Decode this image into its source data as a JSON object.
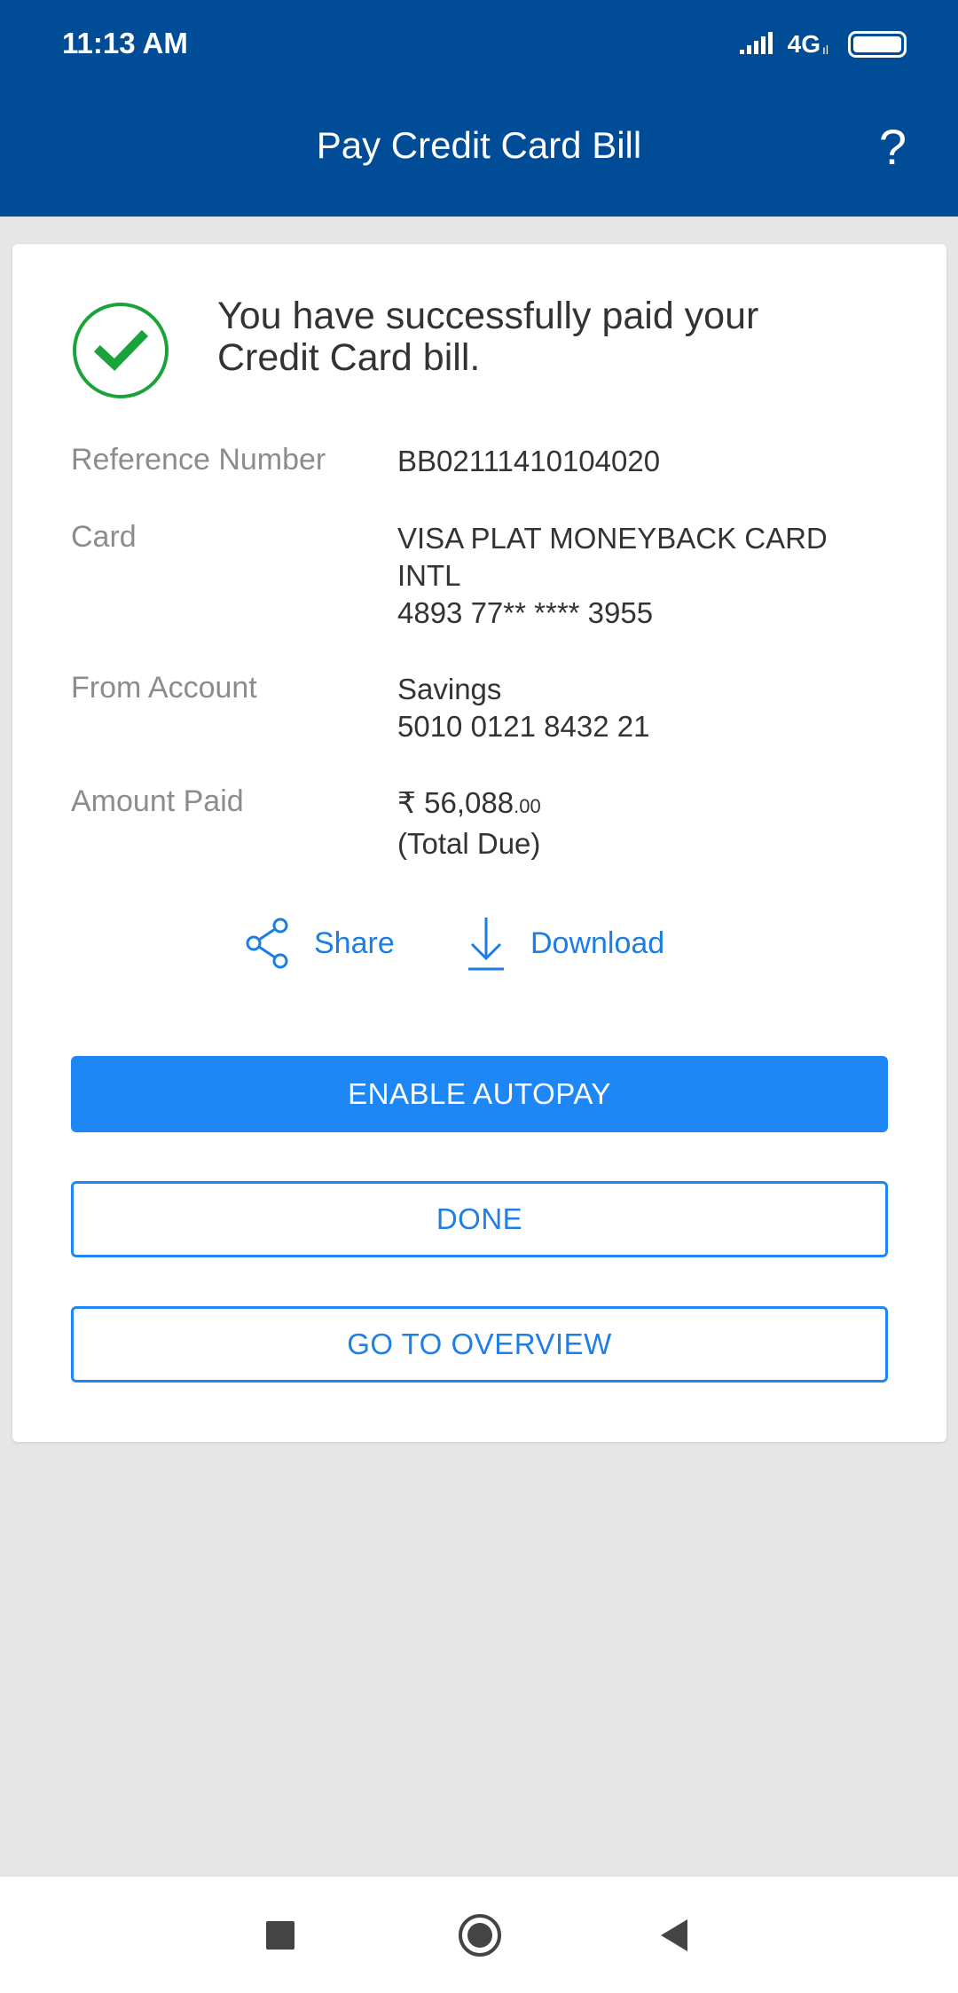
{
  "status_bar": {
    "time": "11:13 AM",
    "network": "4G",
    "network_sub": "ıl",
    "icons": [
      "signal-icon",
      "battery-icon"
    ]
  },
  "header": {
    "title": "Pay Credit Card Bill",
    "help_label": "?"
  },
  "confirmation": {
    "icon": "check-circle-icon",
    "message": "You have successfully paid your Credit Card bill.",
    "details": {
      "reference": {
        "label": "Reference Number",
        "value": "BB02111410104020"
      },
      "card": {
        "label": "Card",
        "line1": "VISA PLAT MONEYBACK CARD",
        "line2": "INTL",
        "line3": "4893 77** **** 3955"
      },
      "from_account": {
        "label": "From Account",
        "line1": "Savings",
        "line2": "5010 0121 8432 21"
      },
      "amount": {
        "label": "Amount Paid",
        "currency": "₹",
        "integer": "56,088",
        "decimal": ".00",
        "note": "(Total Due)"
      }
    },
    "actions": {
      "share_label": "Share",
      "download_label": "Download"
    },
    "buttons": {
      "autopay": "ENABLE AUTOPAY",
      "done": "DONE",
      "overview": "GO TO OVERVIEW"
    }
  },
  "colors": {
    "header_bg": "#004c97",
    "accent": "#1f87f5",
    "success": "#1aa33a",
    "background": "#e6e6e6"
  }
}
